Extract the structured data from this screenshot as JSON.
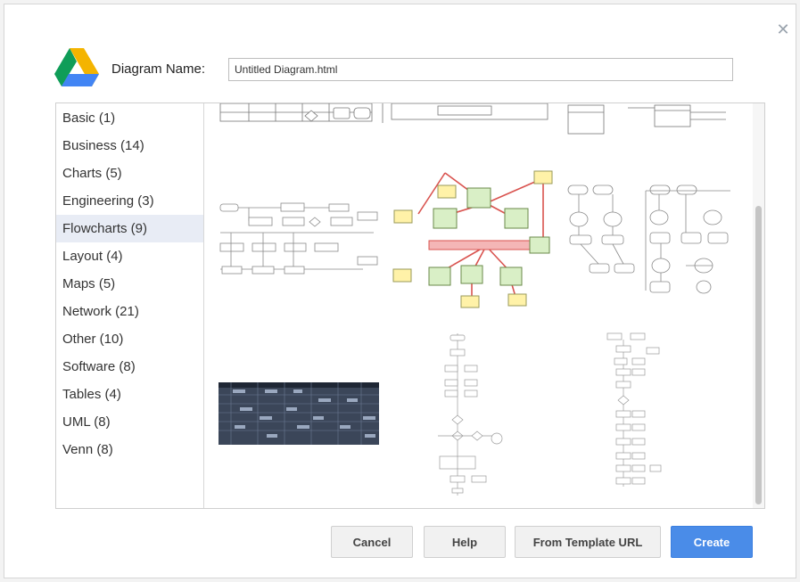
{
  "dialog": {
    "close_icon": "close-icon",
    "logo_icon": "google-drive-icon",
    "name_label": "Diagram Name:",
    "name_value": "Untitled Diagram.html"
  },
  "categories": [
    "Basic (1)",
    "Business (14)",
    "Charts (5)",
    "Engineering (3)",
    "Flowcharts (9)",
    "Layout (4)",
    "Maps (5)",
    "Network (21)",
    "Other (10)",
    "Software (8)",
    "Tables (4)",
    "UML (8)",
    "Venn (8)"
  ],
  "selected_category": "Flowcharts (9)",
  "buttons": {
    "cancel": "Cancel",
    "help": "Help",
    "from_template": "From Template URL",
    "create": "Create"
  },
  "colors": {
    "primary": "#4a8ce8",
    "selected_bg": "#e8ecf5",
    "node_green": "#d9efc6",
    "node_yellow": "#fff2a8",
    "node_pink": "#f4b6b6",
    "edge_red": "#d9534f",
    "table_dark": "#2f3a4e"
  }
}
